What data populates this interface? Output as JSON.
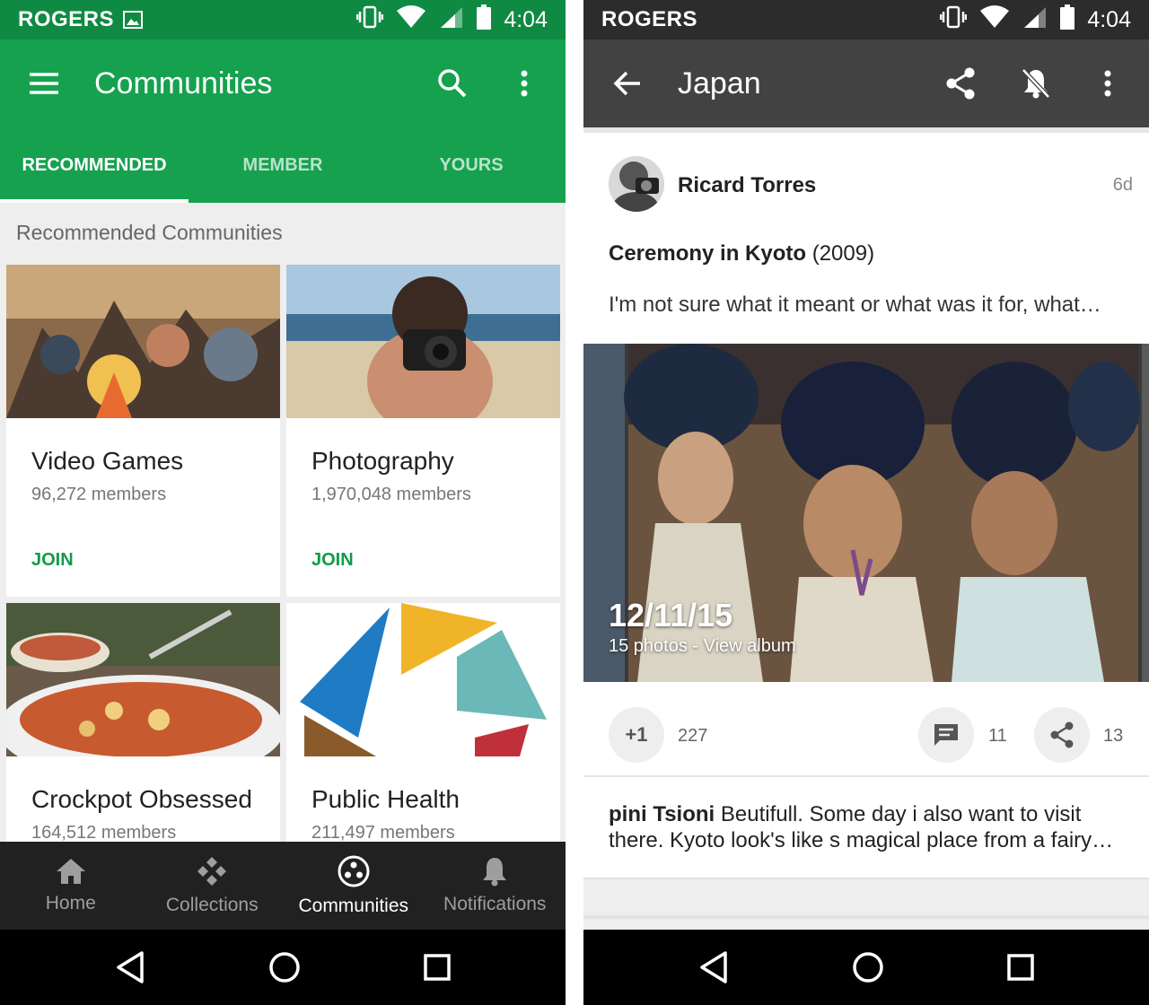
{
  "left": {
    "status": {
      "carrier": "ROGERS",
      "time": "4:04"
    },
    "appbar": {
      "title": "Communities"
    },
    "tabs": [
      {
        "label": "RECOMMENDED",
        "active": true
      },
      {
        "label": "MEMBER",
        "active": false
      },
      {
        "label": "YOURS",
        "active": false
      }
    ],
    "section_title": "Recommended Communities",
    "cards": [
      {
        "name": "Video Games",
        "members": "96,272 members",
        "action": "JOIN"
      },
      {
        "name": "Photography",
        "members": "1,970,048 members",
        "action": "JOIN"
      },
      {
        "name": "Crockpot Obsessed",
        "members": "164,512 members"
      },
      {
        "name": "Public Health",
        "members": "211,497 members"
      }
    ],
    "bottom_nav": [
      {
        "label": "Home",
        "icon": "home-icon",
        "active": false
      },
      {
        "label": "Collections",
        "icon": "collections-icon",
        "active": false
      },
      {
        "label": "Communities",
        "icon": "communities-icon",
        "active": true
      },
      {
        "label": "Notifications",
        "icon": "bell-icon",
        "active": false
      }
    ],
    "colors": {
      "primary": "#16a14f",
      "status": "#0f8a43",
      "join": "#129a4a"
    }
  },
  "right": {
    "status": {
      "carrier": "ROGERS",
      "time": "4:04"
    },
    "appbar": {
      "title": "Japan"
    },
    "post": {
      "author": "Ricard Torres",
      "age": "6d",
      "title_bold": "Ceremony in Kyoto",
      "title_rest": " (2009)",
      "text": "I'm not sure what it meant or what was it for, what…",
      "album_date": "12/11/15",
      "album_sub": "15 photos - View album",
      "plus_label": "+1",
      "plus_count": "227",
      "comment_count": "11",
      "share_count": "13"
    },
    "comment": {
      "author": "pini Tsioni",
      "text": " Beutifull.  Some day i also want to visit there. Kyoto look's like s magical place from a fairy…"
    },
    "colors": {
      "appbar": "#424242",
      "status": "#2c2c2c"
    }
  }
}
